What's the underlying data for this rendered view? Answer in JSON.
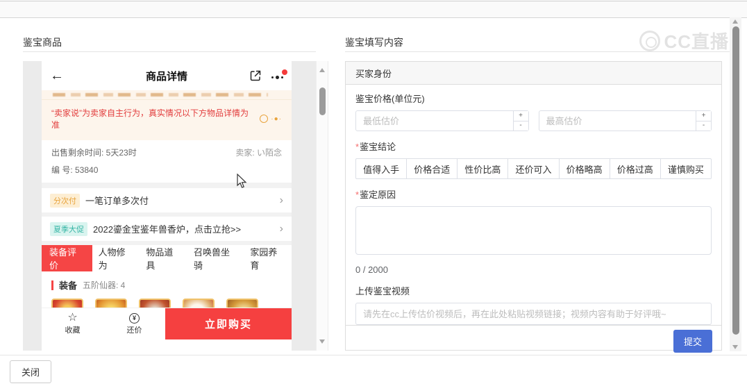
{
  "top_bar": {},
  "left_panel": {
    "title": "鉴宝商品",
    "phone": {
      "header": {
        "title": "商品详情"
      },
      "notice": "“卖家说”为卖家自主行为，真实情况以下方物品详情为准",
      "notice_dots": "·●·",
      "sale_info": {
        "remaining": "出售剩余时间: 5天23时",
        "seller": "卖家: い陌念",
        "item_no": "编 号: 53840"
      },
      "rows": [
        {
          "badge": "分次付",
          "text": "一笔订单多次付"
        },
        {
          "badge": "夏季大促",
          "text": "2022鎏金宝鉴年兽香炉，点击立抢>>"
        }
      ],
      "tabs": [
        "装备评价",
        "人物修为",
        "物品道具",
        "召唤兽坐骑",
        "家园养育"
      ],
      "equip": {
        "title": "装备",
        "subtitle": "五阶仙器: 4",
        "item_count": 5
      },
      "actions": {
        "favorite": "收藏",
        "bargain": "还价",
        "bargain_symbol": "¥",
        "buy": "立即购买"
      }
    }
  },
  "right_panel": {
    "title": "鉴宝填写内容",
    "watermark": "CC直播",
    "form": {
      "section_header": "买家身份",
      "price_label": "鉴宝价格(单位元)",
      "min_placeholder": "最低估价",
      "max_placeholder": "最高估价",
      "spinner_up": "+",
      "spinner_down": "-",
      "conclusion_label": "鉴宝结论",
      "conclusion_options": [
        "值得入手",
        "价格合适",
        "性价比高",
        "还价可入",
        "价格略高",
        "价格过高",
        "谨慎购买"
      ],
      "reason_label": "鉴定原因",
      "reason_value": "",
      "counter": "0 / 2000",
      "video_label": "上传鉴宝视频",
      "video_placeholder": "请先在cc上传估价视频后，再在此处粘贴视频链接；视频内容有助于好评哦~",
      "submit_label": "提交"
    }
  },
  "footer": {
    "close_label": "关闭"
  },
  "icons": {
    "back": "←",
    "chevron": "›",
    "star": "☆"
  },
  "colors": {
    "accent_red": "#f54545",
    "buy_red": "#f54040",
    "submit_blue": "#4a6fd6",
    "badge_orange_text": "#e8a33c",
    "badge_orange_bg": "#fdeed3",
    "badge_teal_text": "#35b5a5",
    "badge_teal_bg": "#d9f4ef",
    "notice_bg": "#fdf5ec",
    "notice_text": "#e23c3c",
    "panel_gray": "#ebebeb"
  }
}
